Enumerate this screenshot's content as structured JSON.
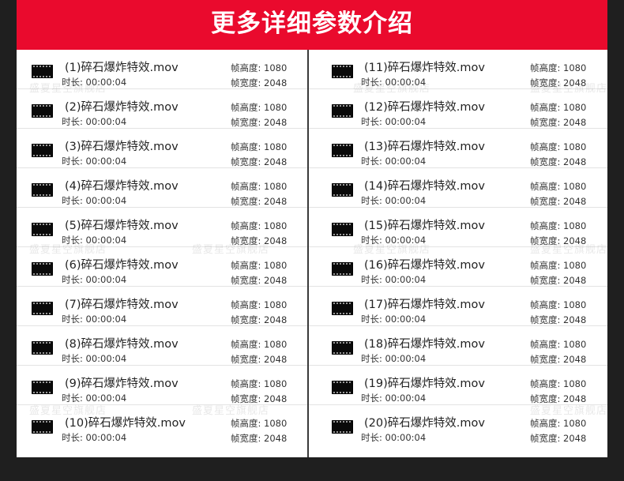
{
  "header": {
    "title": "更多详细参数介绍"
  },
  "watermark": {
    "text": "盛夏星空旗舰店"
  },
  "files": [
    {
      "name": "(1)碎石爆炸特效.mov",
      "duration": "时长: 00:00:04",
      "frame_height": "帧高度: 1080",
      "frame_width": "帧宽度: 2048"
    },
    {
      "name": "(2)碎石爆炸特效.mov",
      "duration": "时长: 00:00:04",
      "frame_height": "帧高度: 1080",
      "frame_width": "帧宽度: 2048"
    },
    {
      "name": "(3)碎石爆炸特效.mov",
      "duration": "时长: 00:00:04",
      "frame_height": "帧高度: 1080",
      "frame_width": "帧宽度: 2048"
    },
    {
      "name": "(4)碎石爆炸特效.mov",
      "duration": "时长: 00:00:04",
      "frame_height": "帧高度: 1080",
      "frame_width": "帧宽度: 2048"
    },
    {
      "name": "(5)碎石爆炸特效.mov",
      "duration": "时长: 00:00:04",
      "frame_height": "帧高度: 1080",
      "frame_width": "帧宽度: 2048"
    },
    {
      "name": "(6)碎石爆炸特效.mov",
      "duration": "时长: 00:00:04",
      "frame_height": "帧高度: 1080",
      "frame_width": "帧宽度: 2048"
    },
    {
      "name": "(7)碎石爆炸特效.mov",
      "duration": "时长: 00:00:04",
      "frame_height": "帧高度: 1080",
      "frame_width": "帧宽度: 2048"
    },
    {
      "name": "(8)碎石爆炸特效.mov",
      "duration": "时长: 00:00:04",
      "frame_height": "帧高度: 1080",
      "frame_width": "帧宽度: 2048"
    },
    {
      "name": "(9)碎石爆炸特效.mov",
      "duration": "时长: 00:00:04",
      "frame_height": "帧高度: 1080",
      "frame_width": "帧宽度: 2048"
    },
    {
      "name": "(10)碎石爆炸特效.mov",
      "duration": "时长: 00:00:04",
      "frame_height": "帧高度: 1080",
      "frame_width": "帧宽度: 2048"
    },
    {
      "name": "(11)碎石爆炸特效.mov",
      "duration": "时长: 00:00:04",
      "frame_height": "帧高度: 1080",
      "frame_width": "帧宽度: 2048"
    },
    {
      "name": "(12)碎石爆炸特效.mov",
      "duration": "时长: 00:00:04",
      "frame_height": "帧高度: 1080",
      "frame_width": "帧宽度: 2048"
    },
    {
      "name": "(13)碎石爆炸特效.mov",
      "duration": "时长: 00:00:04",
      "frame_height": "帧高度: 1080",
      "frame_width": "帧宽度: 2048"
    },
    {
      "name": "(14)碎石爆炸特效.mov",
      "duration": "时长: 00:00:04",
      "frame_height": "帧高度: 1080",
      "frame_width": "帧宽度: 2048"
    },
    {
      "name": "(15)碎石爆炸特效.mov",
      "duration": "时长: 00:00:04",
      "frame_height": "帧高度: 1080",
      "frame_width": "帧宽度: 2048"
    },
    {
      "name": "(16)碎石爆炸特效.mov",
      "duration": "时长: 00:00:04",
      "frame_height": "帧高度: 1080",
      "frame_width": "帧宽度: 2048"
    },
    {
      "name": "(17)碎石爆炸特效.mov",
      "duration": "时长: 00:00:04",
      "frame_height": "帧高度: 1080",
      "frame_width": "帧宽度: 2048"
    },
    {
      "name": "(18)碎石爆炸特效.mov",
      "duration": "时长: 00:00:04",
      "frame_height": "帧高度: 1080",
      "frame_width": "帧宽度: 2048"
    },
    {
      "name": "(19)碎石爆炸特效.mov",
      "duration": "时长: 00:00:04",
      "frame_height": "帧高度: 1080",
      "frame_width": "帧宽度: 2048"
    },
    {
      "name": "(20)碎石爆炸特效.mov",
      "duration": "时长: 00:00:04",
      "frame_height": "帧高度: 1080",
      "frame_width": "帧宽度: 2048"
    }
  ]
}
